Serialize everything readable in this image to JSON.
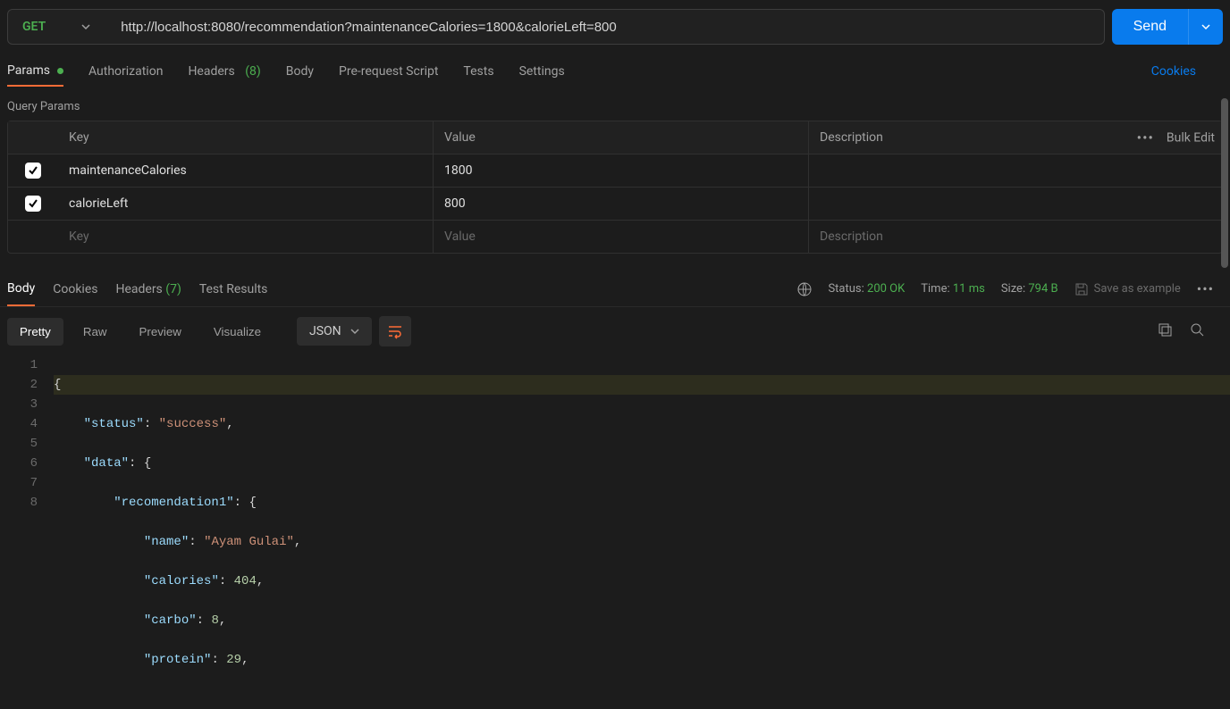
{
  "request": {
    "method": "GET",
    "url": "http://localhost:8080/recommendation?maintenanceCalories=1800&calorieLeft=800",
    "send_label": "Send"
  },
  "request_tabs": {
    "params": "Params",
    "authorization": "Authorization",
    "headers": "Headers",
    "headers_count": "(8)",
    "body": "Body",
    "prerequest": "Pre-request Script",
    "tests": "Tests",
    "settings": "Settings",
    "cookies": "Cookies"
  },
  "query_params": {
    "label": "Query Params",
    "header_key": "Key",
    "header_value": "Value",
    "header_desc": "Description",
    "bulk_edit": "Bulk Edit",
    "rows": [
      {
        "key": "maintenanceCalories",
        "value": "1800",
        "desc": ""
      },
      {
        "key": "calorieLeft",
        "value": "800",
        "desc": ""
      }
    ],
    "placeholder_key": "Key",
    "placeholder_value": "Value",
    "placeholder_desc": "Description"
  },
  "response_tabs": {
    "body": "Body",
    "cookies": "Cookies",
    "headers": "Headers",
    "headers_count": "(7)",
    "test_results": "Test Results"
  },
  "response_meta": {
    "status_label": "Status:",
    "status_value": "200 OK",
    "time_label": "Time:",
    "time_value": "11 ms",
    "size_label": "Size:",
    "size_value": "794 B",
    "save_example": "Save as example"
  },
  "body_view": {
    "pretty": "Pretty",
    "raw": "Raw",
    "preview": "Preview",
    "visualize": "Visualize",
    "format": "JSON"
  },
  "response_json": {
    "line1": "{",
    "line2_key": "\"status\"",
    "line2_val": "\"success\"",
    "line3_key": "\"data\"",
    "line4_key": "\"recomendation1\"",
    "line5_key": "\"name\"",
    "line5_val": "\"Ayam Gulai\"",
    "line6_key": "\"calories\"",
    "line6_val": "404",
    "line7_key": "\"carbo\"",
    "line7_val": "8",
    "line8_key": "\"protein\"",
    "line8_val": "29"
  }
}
